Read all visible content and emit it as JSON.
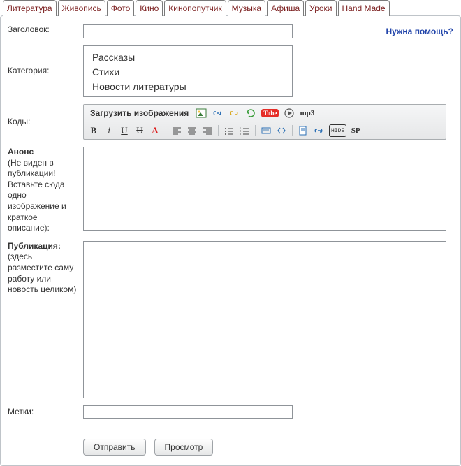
{
  "tabs": {
    "items": [
      {
        "label": "Литература"
      },
      {
        "label": "Живопись"
      },
      {
        "label": "Фото"
      },
      {
        "label": "Кино"
      },
      {
        "label": "Кинопопутчик"
      },
      {
        "label": "Музыка"
      },
      {
        "label": "Афиша"
      },
      {
        "label": "Уроки"
      },
      {
        "label": "Hand Made"
      }
    ]
  },
  "help_link": "Нужна помощь?",
  "labels": {
    "title": "Заголовок:",
    "category": "Категория:",
    "codes": "Коды:",
    "anons_head": "Анонс",
    "anons_desc": "(Не виден в публикации! Вставьте сюда одно изображение и краткое описание):",
    "pub_head": "Публикация:",
    "pub_desc": "(здесь разместите саму работу или новость целиком)",
    "tags": "Метки:"
  },
  "categories": {
    "options": [
      {
        "label": "Рассказы"
      },
      {
        "label": "Стихи"
      },
      {
        "label": "Новости литературы"
      }
    ]
  },
  "toolbar": {
    "upload_label": "Загрузить изображения",
    "mp3_label": "mp3",
    "sp_label": "SP",
    "hide_label": "HIDE",
    "yt_label": "Tube"
  },
  "buttons": {
    "submit": "Отправить",
    "preview": "Просмотр"
  },
  "fields": {
    "title_value": "",
    "tags_value": ""
  }
}
